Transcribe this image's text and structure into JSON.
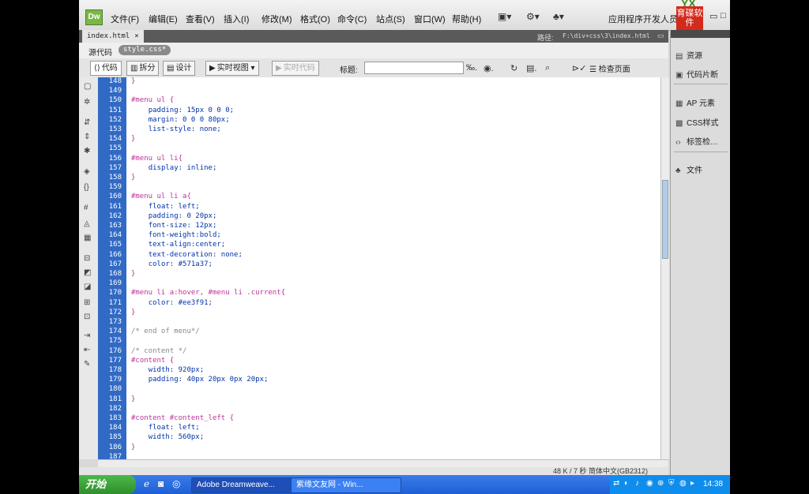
{
  "menubar": {
    "logo": "Dw",
    "items": [
      "文件(F)",
      "编辑(E)",
      "查看(V)",
      "插入(I)",
      "修改(M)",
      "格式(O)",
      "命令(C)",
      "站点(S)",
      "窗口(W)",
      "帮助(H)"
    ],
    "app_developer": "应用程序开发人员",
    "brand_top": "YX",
    "brand_text": "育碟软件",
    "min": "▭",
    "restore": "□"
  },
  "tab": {
    "name": "index.html",
    "close": "×"
  },
  "path": {
    "label": "路径:",
    "value": "F:\\div+css\\3\\index.html"
  },
  "related": {
    "source": "源代码",
    "style_css": "style.css*"
  },
  "toolbar": {
    "code": "代码",
    "split": "拆分",
    "design": "设计",
    "live_view": "实时视图",
    "live_code": "实时代码",
    "title_label": "标题:",
    "title_value": "",
    "preview": "检查页面"
  },
  "code_lines": [
    {
      "n": "148",
      "html": "<span class='brace'>}</span>"
    },
    {
      "n": "149",
      "html": ""
    },
    {
      "n": "150",
      "html": "<span class='sel'>#menu ul {</span>"
    },
    {
      "n": "151",
      "html": "    <span class='prop'>padding: 15px 0 0 0;</span>"
    },
    {
      "n": "152",
      "html": "    <span class='prop'>margin: 0 0 0 80px;</span>"
    },
    {
      "n": "153",
      "html": "    <span class='prop'>list-style: none;</span>"
    },
    {
      "n": "154",
      "html": "<span class='brace'>}</span>"
    },
    {
      "n": "155",
      "html": ""
    },
    {
      "n": "156",
      "html": "<span class='sel'>#menu ul li{</span>"
    },
    {
      "n": "157",
      "html": "    <span class='prop'>display: inline;</span>"
    },
    {
      "n": "158",
      "html": "<span class='brace'>}</span>"
    },
    {
      "n": "159",
      "html": ""
    },
    {
      "n": "160",
      "html": "<span class='sel'>#menu ul li a{</span>"
    },
    {
      "n": "161",
      "html": "    <span class='prop'>float: left;</span>"
    },
    {
      "n": "162",
      "html": "    <span class='prop'>padding: 0 20px;</span>"
    },
    {
      "n": "163",
      "html": "    <span class='prop'>font-size: 12px;</span>"
    },
    {
      "n": "164",
      "html": "    <span class='prop'>font-weight:bold;</span>"
    },
    {
      "n": "165",
      "html": "    <span class='prop'>text-align:center;</span>"
    },
    {
      "n": "166",
      "html": "    <span class='prop'>text-decoration: none;</span>"
    },
    {
      "n": "167",
      "html": "    <span class='prop'>color: #571a37;</span>"
    },
    {
      "n": "168",
      "html": "<span class='brace'>}</span>"
    },
    {
      "n": "169",
      "html": ""
    },
    {
      "n": "170",
      "html": "<span class='sel'>#menu li a:hover, #menu li .current{</span>"
    },
    {
      "n": "171",
      "html": "    <span class='prop'>color: #ee3f91;</span>"
    },
    {
      "n": "172",
      "html": "<span class='brace'>}</span>"
    },
    {
      "n": "173",
      "html": ""
    },
    {
      "n": "174",
      "html": "<span class='comment'>/* end of menu*/</span>"
    },
    {
      "n": "175",
      "html": ""
    },
    {
      "n": "176",
      "html": "<span class='comment'>/* content */</span>"
    },
    {
      "n": "177",
      "html": "<span class='sel'>#content {</span>"
    },
    {
      "n": "178",
      "html": "    <span class='prop'>width: 920px;</span>"
    },
    {
      "n": "179",
      "html": "    <span class='prop'>padding: 40px 20px 0px 20px;</span>"
    },
    {
      "n": "180",
      "html": ""
    },
    {
      "n": "181",
      "html": "<span class='brace'>}</span>"
    },
    {
      "n": "182",
      "html": ""
    },
    {
      "n": "183",
      "html": "<span class='sel'>#content #content_left {</span>"
    },
    {
      "n": "184",
      "html": "    <span class='prop'>float: left;</span>"
    },
    {
      "n": "185",
      "html": "    <span class='prop'>width: 560px;</span>"
    },
    {
      "n": "186",
      "html": "<span class='brace'>}</span>"
    },
    {
      "n": "187",
      "html": ""
    }
  ],
  "status": {
    "text": "48 K / 7 秒  简体中文(GB2312)"
  },
  "panel": {
    "items": [
      "资源",
      "代码片断",
      "AP 元素",
      "CSS样式",
      "标签检…",
      "文件"
    ]
  },
  "taskbar": {
    "start": "开始",
    "tasks": [
      "Adobe Dreamweave...",
      "紫缘文友网 - Win..."
    ],
    "clock": "14:38"
  },
  "colors": {
    "line_number_bg": "#316ac5",
    "selector": "#bb3399",
    "property": "#0033aa",
    "taskbar": "#1f5fd6"
  }
}
